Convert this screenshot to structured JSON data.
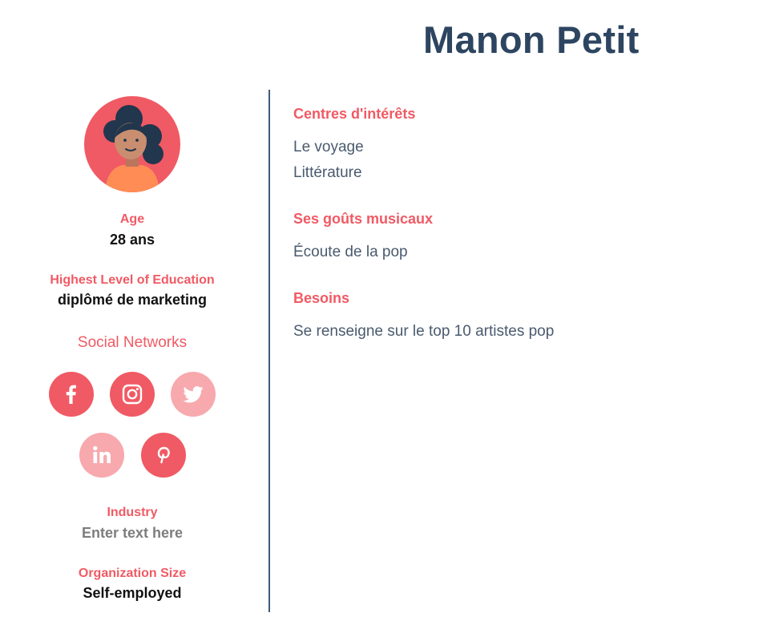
{
  "persona": {
    "name": "Manon Petit"
  },
  "profile": {
    "avatar_icon": "woman-avatar-icon",
    "age": {
      "label": "Age",
      "value": "28 ans"
    },
    "education": {
      "label": "Highest Level of Education",
      "value": "diplômé de marketing"
    },
    "social": {
      "label": "Social Networks",
      "networks": [
        {
          "name": "facebook",
          "icon": "facebook-icon",
          "active": true
        },
        {
          "name": "instagram",
          "icon": "instagram-icon",
          "active": true
        },
        {
          "name": "twitter",
          "icon": "twitter-icon",
          "active": false
        },
        {
          "name": "linkedin",
          "icon": "linkedin-icon",
          "active": false
        },
        {
          "name": "pinterest",
          "icon": "pinterest-icon",
          "active": true
        }
      ]
    },
    "industry": {
      "label": "Industry",
      "value": "Enter text here"
    },
    "org_size": {
      "label": "Organization Size",
      "value": "Self-employed"
    }
  },
  "sections": {
    "interests": {
      "title": "Centres d'intérêts",
      "items": [
        "Le voyage",
        "Littérature"
      ]
    },
    "music": {
      "title": "Ses goûts musicaux",
      "items": [
        "Écoute de la pop"
      ]
    },
    "needs": {
      "title": "Besoins",
      "items": [
        "Se renseigne sur le top 10 artistes pop"
      ]
    }
  },
  "colors": {
    "title": "#2d4560",
    "accent": "#f05a64",
    "accent_light": "#f7a9ae",
    "body_text": "#4a5a6e",
    "divider": "#3e5a78"
  }
}
